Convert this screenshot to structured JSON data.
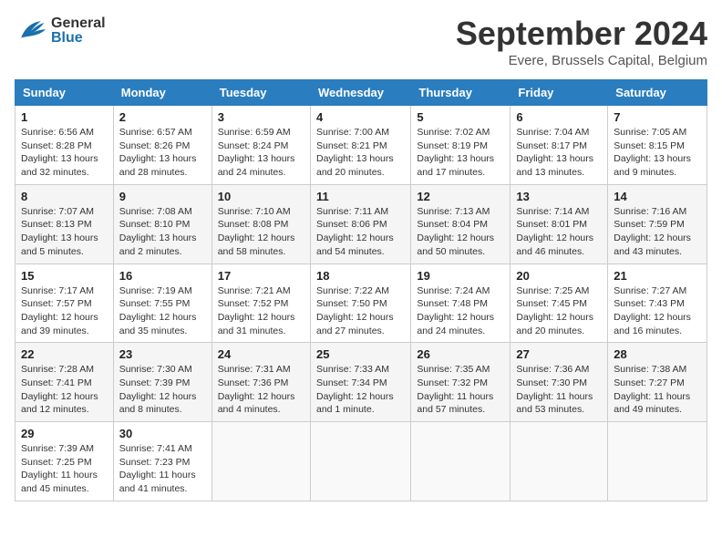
{
  "header": {
    "logo_general": "General",
    "logo_blue": "Blue",
    "title": "September 2024",
    "subtitle": "Evere, Brussels Capital, Belgium"
  },
  "columns": [
    "Sunday",
    "Monday",
    "Tuesday",
    "Wednesday",
    "Thursday",
    "Friday",
    "Saturday"
  ],
  "weeks": [
    [
      {
        "day": "1",
        "sunrise": "Sunrise: 6:56 AM",
        "sunset": "Sunset: 8:28 PM",
        "daylight": "Daylight: 13 hours and 32 minutes."
      },
      {
        "day": "2",
        "sunrise": "Sunrise: 6:57 AM",
        "sunset": "Sunset: 8:26 PM",
        "daylight": "Daylight: 13 hours and 28 minutes."
      },
      {
        "day": "3",
        "sunrise": "Sunrise: 6:59 AM",
        "sunset": "Sunset: 8:24 PM",
        "daylight": "Daylight: 13 hours and 24 minutes."
      },
      {
        "day": "4",
        "sunrise": "Sunrise: 7:00 AM",
        "sunset": "Sunset: 8:21 PM",
        "daylight": "Daylight: 13 hours and 20 minutes."
      },
      {
        "day": "5",
        "sunrise": "Sunrise: 7:02 AM",
        "sunset": "Sunset: 8:19 PM",
        "daylight": "Daylight: 13 hours and 17 minutes."
      },
      {
        "day": "6",
        "sunrise": "Sunrise: 7:04 AM",
        "sunset": "Sunset: 8:17 PM",
        "daylight": "Daylight: 13 hours and 13 minutes."
      },
      {
        "day": "7",
        "sunrise": "Sunrise: 7:05 AM",
        "sunset": "Sunset: 8:15 PM",
        "daylight": "Daylight: 13 hours and 9 minutes."
      }
    ],
    [
      {
        "day": "8",
        "sunrise": "Sunrise: 7:07 AM",
        "sunset": "Sunset: 8:13 PM",
        "daylight": "Daylight: 13 hours and 5 minutes."
      },
      {
        "day": "9",
        "sunrise": "Sunrise: 7:08 AM",
        "sunset": "Sunset: 8:10 PM",
        "daylight": "Daylight: 13 hours and 2 minutes."
      },
      {
        "day": "10",
        "sunrise": "Sunrise: 7:10 AM",
        "sunset": "Sunset: 8:08 PM",
        "daylight": "Daylight: 12 hours and 58 minutes."
      },
      {
        "day": "11",
        "sunrise": "Sunrise: 7:11 AM",
        "sunset": "Sunset: 8:06 PM",
        "daylight": "Daylight: 12 hours and 54 minutes."
      },
      {
        "day": "12",
        "sunrise": "Sunrise: 7:13 AM",
        "sunset": "Sunset: 8:04 PM",
        "daylight": "Daylight: 12 hours and 50 minutes."
      },
      {
        "day": "13",
        "sunrise": "Sunrise: 7:14 AM",
        "sunset": "Sunset: 8:01 PM",
        "daylight": "Daylight: 12 hours and 46 minutes."
      },
      {
        "day": "14",
        "sunrise": "Sunrise: 7:16 AM",
        "sunset": "Sunset: 7:59 PM",
        "daylight": "Daylight: 12 hours and 43 minutes."
      }
    ],
    [
      {
        "day": "15",
        "sunrise": "Sunrise: 7:17 AM",
        "sunset": "Sunset: 7:57 PM",
        "daylight": "Daylight: 12 hours and 39 minutes."
      },
      {
        "day": "16",
        "sunrise": "Sunrise: 7:19 AM",
        "sunset": "Sunset: 7:55 PM",
        "daylight": "Daylight: 12 hours and 35 minutes."
      },
      {
        "day": "17",
        "sunrise": "Sunrise: 7:21 AM",
        "sunset": "Sunset: 7:52 PM",
        "daylight": "Daylight: 12 hours and 31 minutes."
      },
      {
        "day": "18",
        "sunrise": "Sunrise: 7:22 AM",
        "sunset": "Sunset: 7:50 PM",
        "daylight": "Daylight: 12 hours and 27 minutes."
      },
      {
        "day": "19",
        "sunrise": "Sunrise: 7:24 AM",
        "sunset": "Sunset: 7:48 PM",
        "daylight": "Daylight: 12 hours and 24 minutes."
      },
      {
        "day": "20",
        "sunrise": "Sunrise: 7:25 AM",
        "sunset": "Sunset: 7:45 PM",
        "daylight": "Daylight: 12 hours and 20 minutes."
      },
      {
        "day": "21",
        "sunrise": "Sunrise: 7:27 AM",
        "sunset": "Sunset: 7:43 PM",
        "daylight": "Daylight: 12 hours and 16 minutes."
      }
    ],
    [
      {
        "day": "22",
        "sunrise": "Sunrise: 7:28 AM",
        "sunset": "Sunset: 7:41 PM",
        "daylight": "Daylight: 12 hours and 12 minutes."
      },
      {
        "day": "23",
        "sunrise": "Sunrise: 7:30 AM",
        "sunset": "Sunset: 7:39 PM",
        "daylight": "Daylight: 12 hours and 8 minutes."
      },
      {
        "day": "24",
        "sunrise": "Sunrise: 7:31 AM",
        "sunset": "Sunset: 7:36 PM",
        "daylight": "Daylight: 12 hours and 4 minutes."
      },
      {
        "day": "25",
        "sunrise": "Sunrise: 7:33 AM",
        "sunset": "Sunset: 7:34 PM",
        "daylight": "Daylight: 12 hours and 1 minute."
      },
      {
        "day": "26",
        "sunrise": "Sunrise: 7:35 AM",
        "sunset": "Sunset: 7:32 PM",
        "daylight": "Daylight: 11 hours and 57 minutes."
      },
      {
        "day": "27",
        "sunrise": "Sunrise: 7:36 AM",
        "sunset": "Sunset: 7:30 PM",
        "daylight": "Daylight: 11 hours and 53 minutes."
      },
      {
        "day": "28",
        "sunrise": "Sunrise: 7:38 AM",
        "sunset": "Sunset: 7:27 PM",
        "daylight": "Daylight: 11 hours and 49 minutes."
      }
    ],
    [
      {
        "day": "29",
        "sunrise": "Sunrise: 7:39 AM",
        "sunset": "Sunset: 7:25 PM",
        "daylight": "Daylight: 11 hours and 45 minutes."
      },
      {
        "day": "30",
        "sunrise": "Sunrise: 7:41 AM",
        "sunset": "Sunset: 7:23 PM",
        "daylight": "Daylight: 11 hours and 41 minutes."
      },
      null,
      null,
      null,
      null,
      null
    ]
  ]
}
